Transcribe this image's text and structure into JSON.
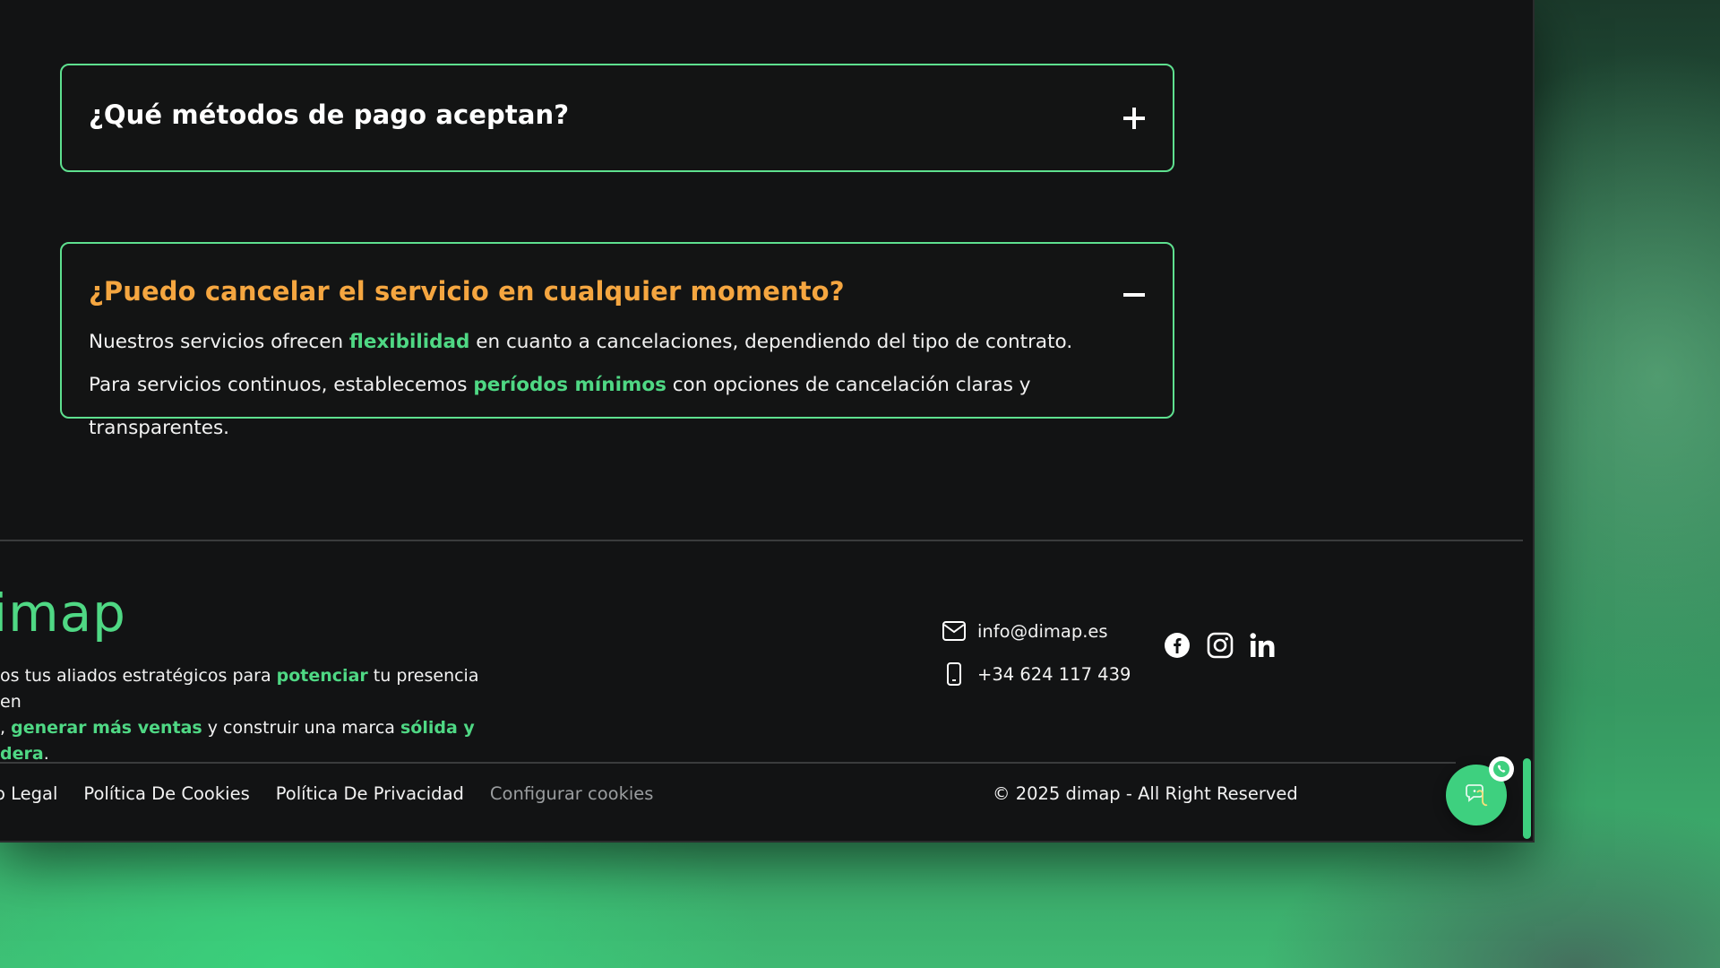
{
  "faq": [
    {
      "question": "¿Qué métodos de pago aceptan?",
      "toggle_icon": "plus-icon",
      "expanded": false
    },
    {
      "question": "¿Puedo cancelar el servicio en cualquier momento?",
      "toggle_icon": "minus-icon",
      "expanded": true,
      "answer": {
        "line1_a": "Nuestros servicios ofrecen ",
        "line1_hl": "flexibilidad",
        "line1_b": " en cuanto a cancelaciones, dependiendo del tipo de contrato.",
        "line2_a": "Para servicios continuos, establecemos ",
        "line2_hl": "períodos mínimos",
        "line2_b": " con opciones de cancelación claras y transparentes."
      }
    }
  ],
  "footer": {
    "logo_text": "imap",
    "tagline": {
      "p1": "os tus aliados estratégicos para ",
      "hl1": "potenciar",
      "p2": " tu presencia en",
      "p3": ", ",
      "hl2": "generar más ventas",
      "p4": " y construir una marca ",
      "hl3": "sólida y",
      "hl4": "dera",
      "p5": "."
    },
    "contact": {
      "email": "info@dimap.es",
      "phone": "+34 624 117 439"
    },
    "social": [
      "facebook-icon",
      "instagram-icon",
      "linkedin-icon"
    ],
    "legal_links": [
      "o Legal",
      "Política De Cookies",
      "Política De Privacidad",
      "Configurar cookies"
    ],
    "copyright": "© 2025 dimap - All Right Reserved"
  },
  "colors": {
    "accent_green": "#4fd884",
    "question_active": "#f5a640",
    "panel_bg": "#121314",
    "border_green": "#5ee08f"
  }
}
